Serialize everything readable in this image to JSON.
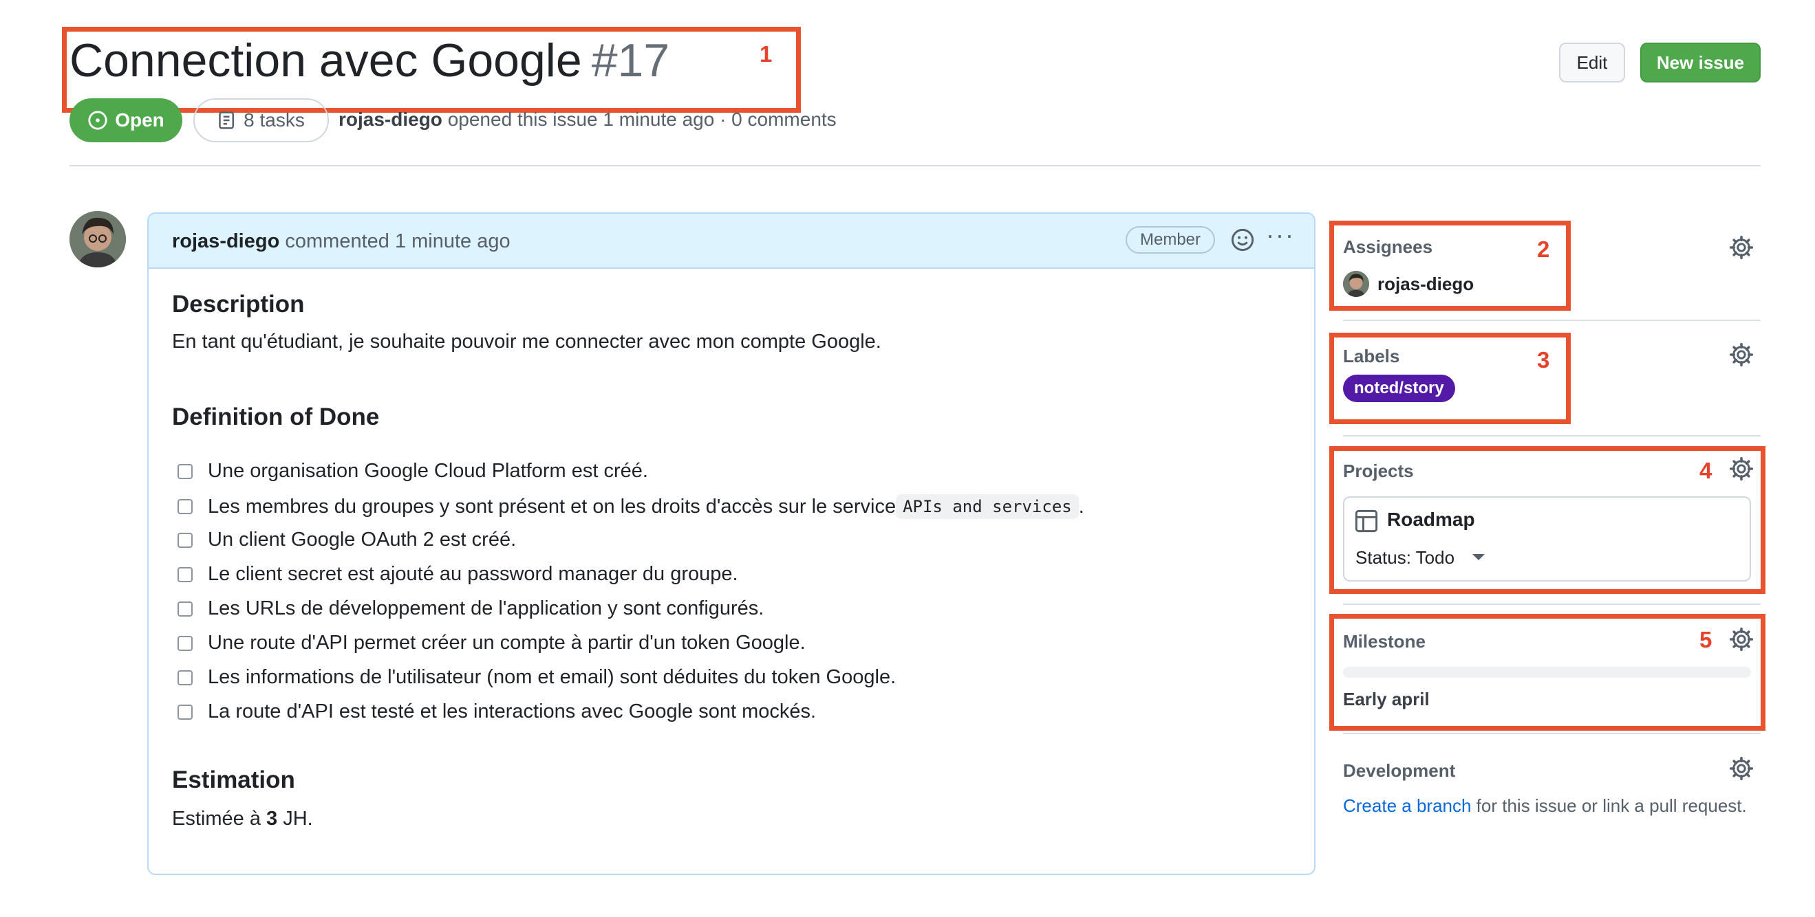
{
  "issue": {
    "title": "Connection avec Google",
    "number": "#17",
    "state": "Open",
    "tasks": "8 tasks",
    "author": "rojas-diego",
    "meta_suffix": "opened this issue 1 minute ago · 0 comments"
  },
  "header_buttons": {
    "edit": "Edit",
    "new_issue": "New issue"
  },
  "comment": {
    "author": "rojas-diego",
    "time": "commented 1 minute ago",
    "role_badge": "Member",
    "description_heading": "Description",
    "description": "En tant qu'étudiant, je souhaite pouvoir me connecter avec mon compte Google.",
    "dod_heading": "Definition of Done",
    "tasks": [
      {
        "text": "Une organisation Google Cloud Platform est créé."
      },
      {
        "text": "Les membres du groupes y sont présent et on les droits d'accès sur le service ",
        "code": "APIs and services",
        "suffix": "."
      },
      {
        "text": "Un client Google OAuth 2 est créé."
      },
      {
        "text": "Le client secret est ajouté au password manager du groupe."
      },
      {
        "text": "Les URLs de développement de l'application y sont configurés."
      },
      {
        "text": "Une route d'API permet créer un compte à partir d'un token Google."
      },
      {
        "text": "Les informations de l'utilisateur (nom et email) sont déduites du token Google."
      },
      {
        "text": "La route d'API est testé et les interactions avec Google sont mockés."
      }
    ],
    "estimation_heading": "Estimation",
    "estimation_prefix": "Estimée à ",
    "estimation_value": "3",
    "estimation_suffix": " JH."
  },
  "sidebar": {
    "assignees": {
      "label": "Assignees",
      "user": "rojas-diego"
    },
    "labels": {
      "label": "Labels",
      "items": [
        {
          "name": "noted/story",
          "color": "#5319a7"
        }
      ]
    },
    "projects": {
      "label": "Projects",
      "project": "Roadmap",
      "status": "Status: Todo"
    },
    "milestone": {
      "label": "Milestone",
      "name": "Early april",
      "progress": 0
    },
    "development": {
      "label": "Development",
      "link": "Create a branch",
      "suffix": " for this issue or link a pull request."
    }
  },
  "annotations": [
    "1",
    "2",
    "3",
    "4",
    "5"
  ],
  "colors": {
    "open_green": "#4fa84b",
    "annotation_red": "#e8532f",
    "link_blue": "#0969da",
    "label_purple": "#5319a7"
  }
}
